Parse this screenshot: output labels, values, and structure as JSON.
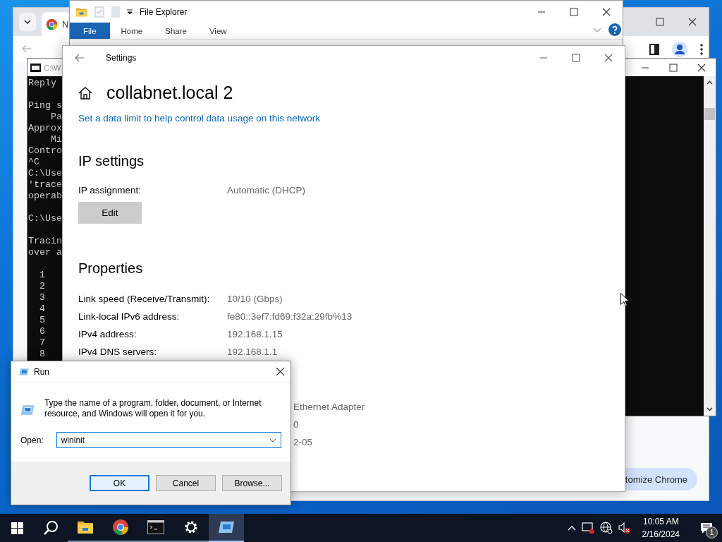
{
  "chrome_window": {
    "tab_title": "N",
    "customize_button": "tomize Chrome"
  },
  "cmd_window": {
    "title": "C:\\W",
    "blocks": [
      [
        "Reply"
      ],
      [
        "Ping s",
        "    Pa",
        "Approx",
        "    Mi",
        "Contro",
        "^C",
        "C:\\Use",
        "'trace",
        "operab"
      ],
      [
        "C:\\Use"
      ],
      [
        "Tracin",
        "over a"
      ],
      [
        "  1",
        "  2",
        "  3",
        "  4",
        "  5",
        "  6",
        "  7",
        "  8"
      ]
    ]
  },
  "file_explorer": {
    "title": "File Explorer",
    "ribbon_tabs": [
      {
        "label": "File",
        "selected": true
      },
      {
        "label": "Home",
        "selected": false
      },
      {
        "label": "Share",
        "selected": false
      },
      {
        "label": "View",
        "selected": false
      }
    ]
  },
  "settings": {
    "title": "Settings",
    "heading": "collabnet.local 2",
    "link": "Set a data limit to help control data usage on this network",
    "ip_settings": {
      "title": "IP settings",
      "rows": [
        {
          "label": "IP assignment:",
          "value": "Automatic (DHCP)"
        }
      ],
      "edit_button": "Edit"
    },
    "properties": {
      "title": "Properties",
      "rows": [
        {
          "label": "Link speed (Receive/Transmit):",
          "value": "10/10 (Gbps)"
        },
        {
          "label": "Link-local IPv6 address:",
          "value": "fe80::3ef7:fd69:f32a:29fb%13"
        },
        {
          "label": "IPv4 address:",
          "value": "192.168.1.15"
        },
        {
          "label": "IPv4 DNS servers:",
          "value": "192.168.1.1"
        }
      ],
      "partial_values": [
        "Ethernet Adapter",
        "0",
        "2-05"
      ]
    }
  },
  "run_dialog": {
    "title": "Run",
    "message": "Type the name of a program, folder, document, or Internet resource, and Windows will open it for you.",
    "open_label": "Open:",
    "value": "wininit",
    "buttons": [
      {
        "label": "OK",
        "default": true
      },
      {
        "label": "Cancel",
        "default": false
      },
      {
        "label": "Browse...",
        "default": false
      }
    ]
  },
  "taskbar": {
    "apps": [
      {
        "kind": "explorer",
        "selected": false
      },
      {
        "kind": "chrome",
        "selected": false
      },
      {
        "kind": "terminal",
        "selected": false
      },
      {
        "kind": "settings",
        "selected": false
      },
      {
        "kind": "run",
        "selected": true
      }
    ],
    "time": "10:05 AM",
    "date": "2/16/2024",
    "notification_count": "1"
  }
}
